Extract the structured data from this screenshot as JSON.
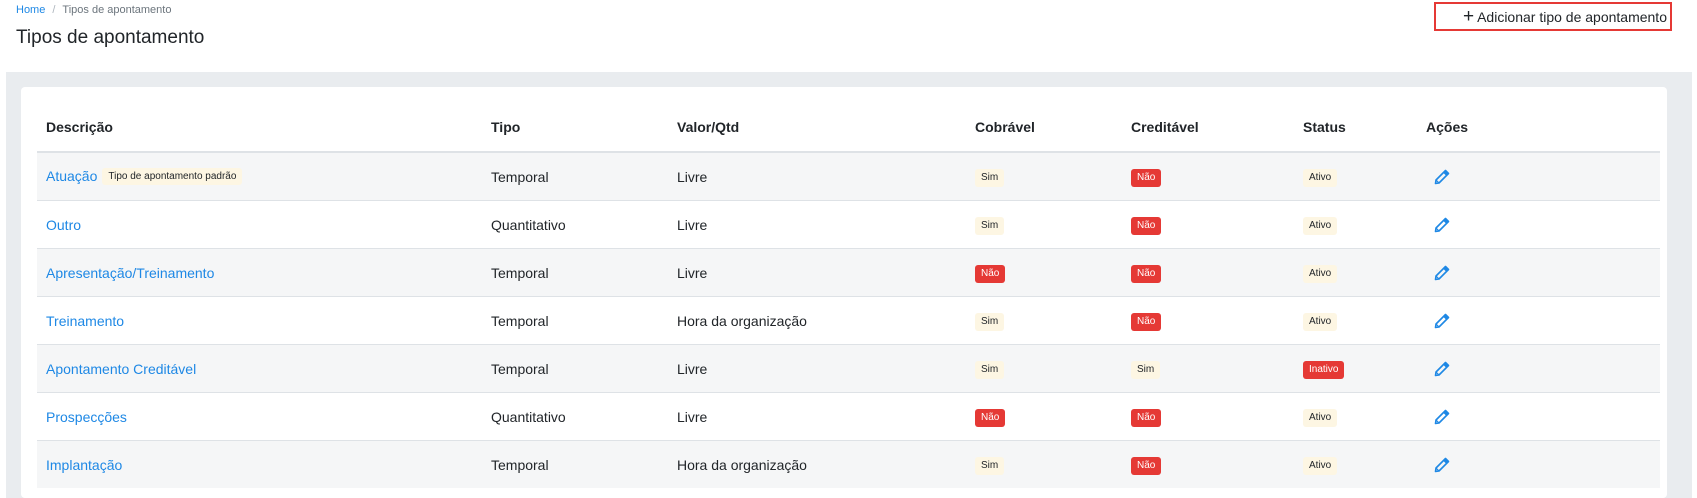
{
  "breadcrumb": {
    "home": "Home",
    "separator": "/",
    "current": "Tipos de apontamento"
  },
  "page": {
    "title": "Tipos de apontamento",
    "add_button_label": "Adicionar tipo de apontamento"
  },
  "table": {
    "headers": {
      "descricao": "Descrição",
      "tipo": "Tipo",
      "valor": "Valor/Qtd",
      "cobravel": "Cobrável",
      "creditavel": "Creditável",
      "status": "Status",
      "acoes": "Ações"
    },
    "rows": [
      {
        "descricao": "Atuação",
        "default_badge": "Tipo de apontamento padrão",
        "tipo": "Temporal",
        "valor": "Livre",
        "cobravel": "Sim",
        "creditavel": "Não",
        "status": "Ativo"
      },
      {
        "descricao": "Outro",
        "tipo": "Quantitativo",
        "valor": "Livre",
        "cobravel": "Sim",
        "creditavel": "Não",
        "status": "Ativo"
      },
      {
        "descricao": "Apresentação/Treinamento",
        "tipo": "Temporal",
        "valor": "Livre",
        "cobravel": "Não",
        "creditavel": "Não",
        "status": "Ativo"
      },
      {
        "descricao": "Treinamento",
        "tipo": "Temporal",
        "valor": "Hora da organização",
        "cobravel": "Sim",
        "creditavel": "Não",
        "status": "Ativo"
      },
      {
        "descricao": "Apontamento Creditável",
        "tipo": "Temporal",
        "valor": "Livre",
        "cobravel": "Sim",
        "creditavel": "Sim",
        "status": "Inativo"
      },
      {
        "descricao": "Prospecções",
        "tipo": "Quantitativo",
        "valor": "Livre",
        "cobravel": "Não",
        "creditavel": "Não",
        "status": "Ativo"
      },
      {
        "descricao": "Implantação",
        "tipo": "Temporal",
        "valor": "Hora da organização",
        "cobravel": "Sim",
        "creditavel": "Não",
        "status": "Ativo"
      }
    ]
  },
  "icons": {
    "add": "plus-icon",
    "edit": "pencil-icon"
  },
  "colors": {
    "link": "#1e88e5",
    "danger": "#e53935",
    "neutral_badge": "#fdf6e3",
    "highlight_border": "#e53935"
  }
}
